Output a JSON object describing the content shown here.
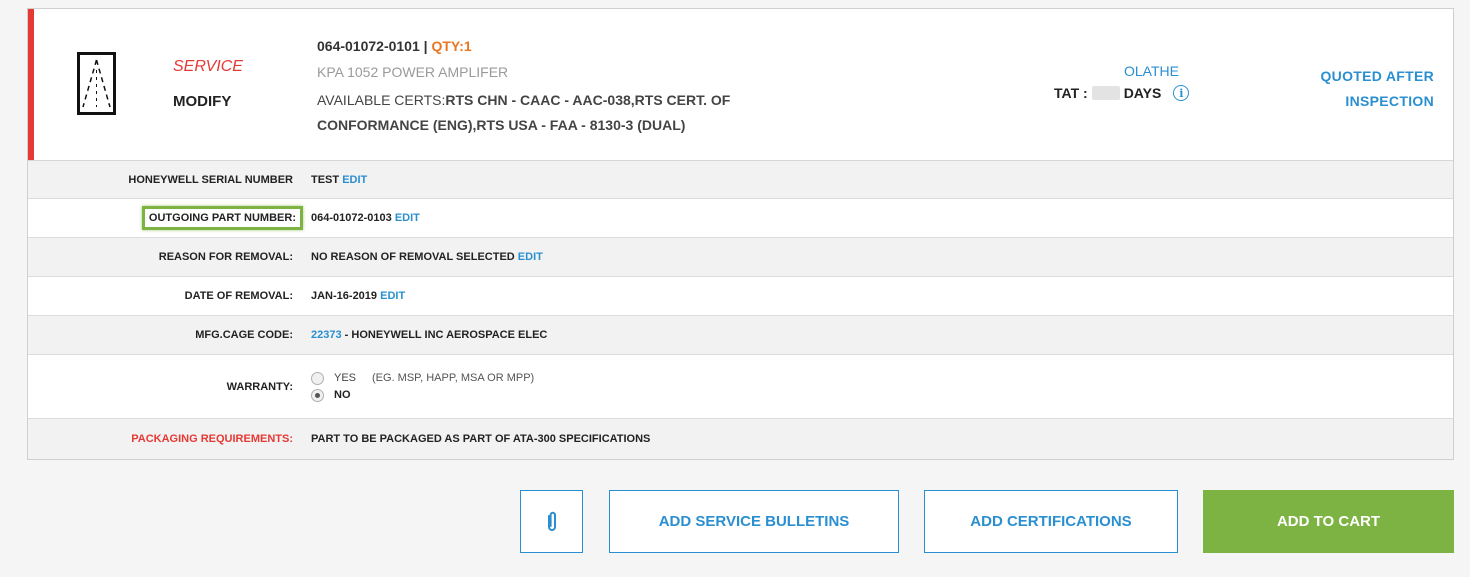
{
  "header": {
    "service_type": "SERVICE",
    "service_action": "MODIFY",
    "part_number": "064-01072-0101",
    "separator": "|",
    "qty_label": "QTY:1",
    "description": "KPA 1052 POWER AMPLIFER",
    "certs_label": "AVAILABLE CERTS:",
    "certs_value": "RTS CHN - CAAC - AAC-038,RTS CERT. OF CONFORMANCE (ENG),RTS USA - FAA - 8130-3 (DUAL)",
    "location": "OLATHE",
    "tat_label": "TAT :",
    "tat_unit": "DAYS",
    "quote_status": "QUOTED AFTER INSPECTION",
    "product_icon": "aircraft-door-icon",
    "info_icon": "info-icon"
  },
  "rows": [
    {
      "label": "HONEYWELL SERIAL NUMBER",
      "value": "TEST",
      "edit": "EDIT"
    },
    {
      "label": "OUTGOING PART NUMBER:",
      "value": "064-01072-0103",
      "edit": "EDIT"
    },
    {
      "label": "REASON FOR REMOVAL:",
      "value": "NO REASON OF REMOVAL SELECTED",
      "edit": "EDIT"
    },
    {
      "label": "DATE OF REMOVAL:",
      "value": "JAN-16-2019",
      "edit": "EDIT"
    },
    {
      "label": "MFG.CAGE CODE:",
      "code": "22373",
      "value": "- HONEYWELL INC AEROSPACE ELEC"
    },
    {
      "label": "WARRANTY:",
      "option_yes": "YES",
      "note": "(EG. MSP, HAPP, MSA OR MPP)",
      "option_no": "NO",
      "selected": "NO"
    },
    {
      "label": "PACKAGING REQUIREMENTS:",
      "value": "PART TO BE PACKAGED AS PART OF ATA-300 SPECIFICATIONS"
    }
  ],
  "buttons": {
    "attach_icon": "paperclip-icon",
    "service_bulletins": "ADD SERVICE BULLETINS",
    "certifications": "ADD CERTIFICATIONS",
    "add_to_cart": "ADD TO CART"
  },
  "colors": {
    "accent_blue": "#2a8fd0",
    "accent_red": "#e53935",
    "qty_orange": "#e87722",
    "cart_green": "#7cb342"
  }
}
